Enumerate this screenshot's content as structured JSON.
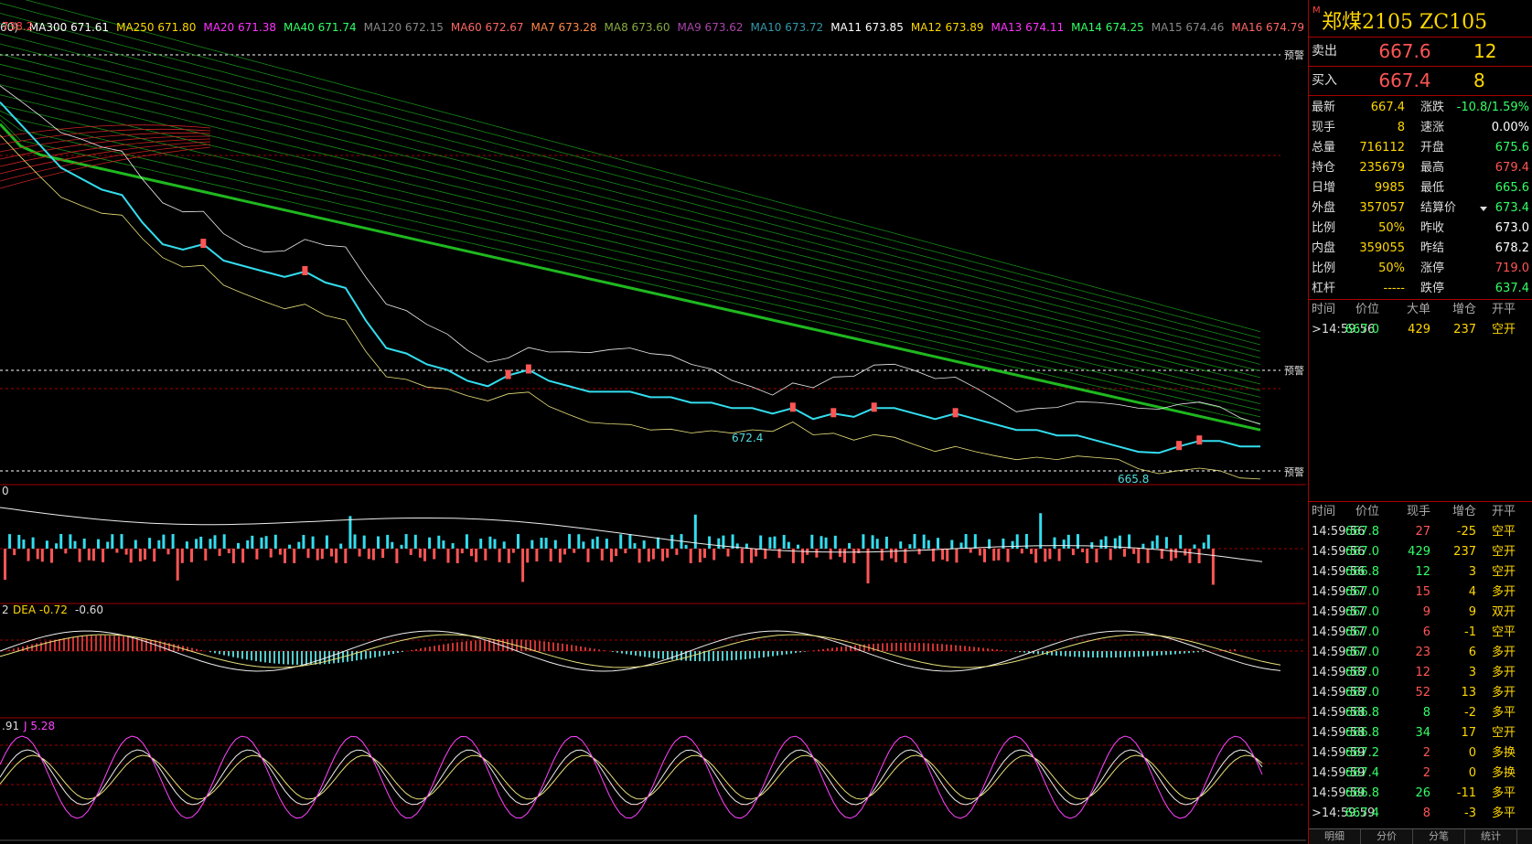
{
  "chart": {
    "top_label": "60)",
    "high_marker": "738.2",
    "low1_label": "672.4",
    "low2_label": "665.8",
    "alert_label": "预警",
    "ma_legend": [
      {
        "text": "MA300 671.61",
        "color": "#ffffff"
      },
      {
        "text": "MA250 671.80",
        "color": "#ffd700"
      },
      {
        "text": "MA20 671.38",
        "color": "#ff33ff"
      },
      {
        "text": "MA40 671.74",
        "color": "#33ff66"
      },
      {
        "text": "MA120 672.15",
        "color": "#888888"
      },
      {
        "text": "MA60 672.67",
        "color": "#ff6666"
      },
      {
        "text": "MA7 673.28",
        "color": "#ff8844"
      },
      {
        "text": "MA8 673.60",
        "color": "#88aa44"
      },
      {
        "text": "MA9 673.62",
        "color": "#aa44aa"
      },
      {
        "text": "MA10 673.72",
        "color": "#3399aa"
      },
      {
        "text": "MA11 673.85",
        "color": "#ffffff"
      },
      {
        "text": "MA12 673.89",
        "color": "#ffd700"
      },
      {
        "text": "MA13 674.11",
        "color": "#ff33ff"
      },
      {
        "text": "MA14 674.25",
        "color": "#33ff66"
      },
      {
        "text": "MA15 674.46",
        "color": "#888888"
      },
      {
        "text": "MA16 674.79",
        "color": "#ff6666"
      }
    ],
    "vol_label": "0",
    "macd_label_a": "2",
    "macd_label_dea": "DEA -0.72",
    "macd_label_c": "-0.60",
    "kdj_label_a": ".91",
    "kdj_label_j": "J 5.28"
  },
  "chart_data": {
    "type": "line",
    "price_series": [
      730,
      726,
      722,
      718,
      716,
      714,
      713,
      708,
      704,
      703,
      704,
      701,
      700,
      699,
      698,
      699,
      697,
      696,
      690,
      685,
      684,
      682,
      681,
      679,
      678,
      680,
      681,
      679,
      678,
      677,
      677,
      677,
      676,
      676,
      675,
      675,
      674,
      674,
      673,
      674,
      672,
      673,
      672.4,
      674,
      674,
      673,
      672,
      673,
      672,
      671,
      670,
      670,
      669,
      669,
      668,
      667,
      666,
      665.8,
      667,
      668,
      668,
      667,
      667
    ],
    "high": 738.2,
    "lows": [
      672.4,
      665.8
    ],
    "last": 667.4
  },
  "quote": {
    "m_mark": "M",
    "title": "郑煤2105  ZC105",
    "sell_label": "卖出",
    "sell_price": "667.6",
    "sell_qty": "12",
    "buy_label": "买入",
    "buy_price": "667.4",
    "buy_qty": "8"
  },
  "stats": [
    {
      "l1": "最新",
      "v1": "667.4",
      "l2": "涨跌",
      "v2": "-10.8/1.59%",
      "c2": "#33ff66"
    },
    {
      "l1": "现手",
      "v1": "8",
      "l2": "速涨",
      "v2": "0.00%",
      "c2": "#ffffff"
    },
    {
      "l1": "总量",
      "v1": "716112",
      "l2": "开盘",
      "v2": "675.6",
      "c2": "#33ff66"
    },
    {
      "l1": "持仓",
      "v1": "235679",
      "l2": "最高",
      "v2": "679.4",
      "c2": "#ff5555"
    },
    {
      "l1": "日增",
      "v1": "9985",
      "l2": "最低",
      "v2": "665.6",
      "c2": "#33ff66"
    },
    {
      "l1": "外盘",
      "v1": "357057",
      "l2": "结算价",
      "v2": "673.4",
      "c2": "#33ff66"
    },
    {
      "l1": "比例",
      "v1": "50%",
      "l2": "昨收",
      "v2": "673.0",
      "c2": "#ffffff"
    },
    {
      "l1": "内盘",
      "v1": "359055",
      "l2": "昨结",
      "v2": "678.2",
      "c2": "#ffffff"
    },
    {
      "l1": "比例",
      "v1": "50%",
      "l2": "涨停",
      "v2": "719.0",
      "c2": "#ff5555"
    },
    {
      "l1": "杠杆",
      "v1": "-----",
      "l2": "跌停",
      "v2": "637.4",
      "c2": "#33ff66"
    }
  ],
  "big_ticks_header": {
    "time": "时间",
    "price": "价位",
    "vol": "大单",
    "oi": "增仓",
    "type": "开平"
  },
  "big_ticks": [
    {
      "time": ">14:59:56",
      "price": "667.0",
      "vol": "429",
      "oi": "237",
      "type": "空开"
    }
  ],
  "ticks_header": {
    "time": "时间",
    "price": "价位",
    "vol": "现手",
    "oi": "增仓",
    "type": "开平"
  },
  "ticks": [
    {
      "time": "14:59:56",
      "price": "667.8",
      "vol": "27",
      "oi": "-25",
      "type": "空平",
      "pc": "#33ff66",
      "vc": "#ff5555"
    },
    {
      "time": "14:59:56",
      "price": "667.0",
      "vol": "429",
      "oi": "237",
      "type": "空开",
      "pc": "#33ff66",
      "vc": "#33ff66"
    },
    {
      "time": "14:59:56",
      "price": "666.8",
      "vol": "12",
      "oi": "3",
      "type": "空开",
      "pc": "#33ff66",
      "vc": "#33ff66"
    },
    {
      "time": "14:59:57",
      "price": "667.0",
      "vol": "15",
      "oi": "4",
      "type": "多开",
      "pc": "#33ff66",
      "vc": "#ff5555"
    },
    {
      "time": "14:59:57",
      "price": "667.0",
      "vol": "9",
      "oi": "9",
      "type": "双开",
      "pc": "#33ff66",
      "vc": "#ff5555"
    },
    {
      "time": "14:59:57",
      "price": "667.0",
      "vol": "6",
      "oi": "-1",
      "type": "空平",
      "pc": "#33ff66",
      "vc": "#ff5555"
    },
    {
      "time": "14:59:57",
      "price": "667.0",
      "vol": "23",
      "oi": "6",
      "type": "多开",
      "pc": "#33ff66",
      "vc": "#ff5555"
    },
    {
      "time": "14:59:58",
      "price": "667.0",
      "vol": "12",
      "oi": "3",
      "type": "多开",
      "pc": "#33ff66",
      "vc": "#ff5555"
    },
    {
      "time": "14:59:58",
      "price": "667.0",
      "vol": "52",
      "oi": "13",
      "type": "多开",
      "pc": "#33ff66",
      "vc": "#ff5555"
    },
    {
      "time": "14:59:58",
      "price": "666.8",
      "vol": "8",
      "oi": "-2",
      "type": "多平",
      "pc": "#33ff66",
      "vc": "#33ff66"
    },
    {
      "time": "14:59:58",
      "price": "666.8",
      "vol": "34",
      "oi": "17",
      "type": "空开",
      "pc": "#33ff66",
      "vc": "#33ff66"
    },
    {
      "time": "14:59:59",
      "price": "667.2",
      "vol": "2",
      "oi": "0",
      "type": "多换",
      "pc": "#33ff66",
      "vc": "#ff5555"
    },
    {
      "time": "14:59:59",
      "price": "667.4",
      "vol": "2",
      "oi": "0",
      "type": "多换",
      "pc": "#33ff66",
      "vc": "#ff5555"
    },
    {
      "time": "14:59:59",
      "price": "666.8",
      "vol": "26",
      "oi": "-11",
      "type": "多平",
      "pc": "#33ff66",
      "vc": "#33ff66"
    },
    {
      "time": ">14:59:59",
      "price": "667.4",
      "vol": "8",
      "oi": "-3",
      "type": "多平",
      "pc": "#33ff66",
      "vc": "#ff5555"
    }
  ],
  "bottom_tabs": [
    "明细",
    "分价",
    "分笔",
    "统计"
  ],
  "colors": {
    "up": "#ff5555",
    "down": "#33ddee",
    "grid": "#a00000",
    "ma_green": "#22cc22"
  }
}
